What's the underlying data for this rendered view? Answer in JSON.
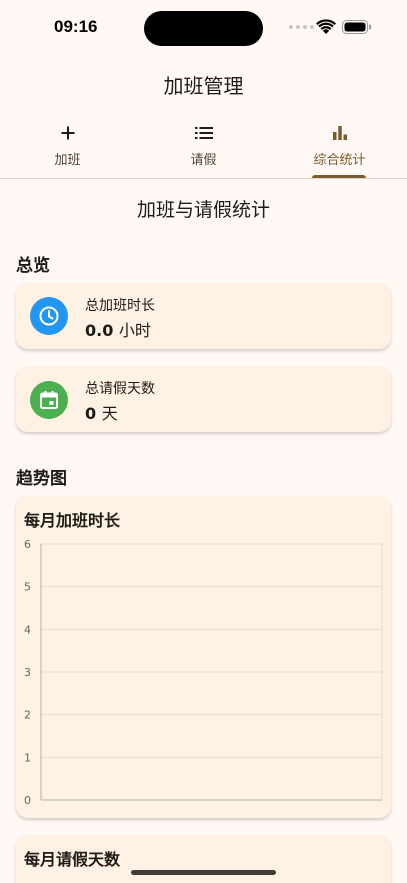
{
  "status_bar": {
    "time": "09:16"
  },
  "app": {
    "title": "加班管理"
  },
  "tabs": [
    {
      "label": "加班",
      "icon": "plus-icon",
      "active": false
    },
    {
      "label": "请假",
      "icon": "list-icon",
      "active": false
    },
    {
      "label": "综合统计",
      "icon": "bar-chart-icon",
      "active": true
    }
  ],
  "page": {
    "heading": "加班与请假统计"
  },
  "overview": {
    "title": "总览",
    "overtime": {
      "label": "总加班时长",
      "value": "0.0",
      "unit": "小时",
      "icon": "clock-icon",
      "color": "#2196f3"
    },
    "leave": {
      "label": "总请假天数",
      "value": "0",
      "unit": "天",
      "icon": "calendar-icon",
      "color": "#4caf50"
    }
  },
  "trends": {
    "title": "趋势图",
    "overtime_chart_title": "每月加班时长",
    "leave_chart_title": "每月请假天数"
  },
  "colors": {
    "accent": "#7b5a2c",
    "background": "#fff8f4",
    "card": "#fff1e4"
  },
  "chart_data": [
    {
      "type": "line",
      "title": "每月加班时长",
      "x": [],
      "series": [],
      "ylim": [
        0,
        6
      ],
      "yticks": [
        "0",
        "1",
        "2",
        "3",
        "4",
        "5",
        "6"
      ],
      "grid": true
    }
  ]
}
